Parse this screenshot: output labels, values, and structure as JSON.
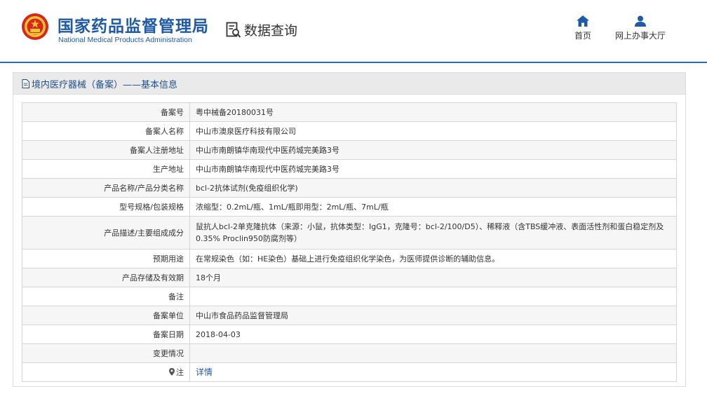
{
  "header": {
    "logo_cn": "国家药品监督管理局",
    "logo_en": "National Medical Products Administration",
    "query_label": "数据查询",
    "nav": [
      {
        "label": "首页",
        "icon": "home-icon"
      },
      {
        "label": "网上办事大厅",
        "icon": "user-icon"
      }
    ]
  },
  "panel": {
    "title": "境内医疗器械（备案）——基本信息"
  },
  "rows": [
    {
      "label": "备案号",
      "value": "粤中械备20180031号"
    },
    {
      "label": "备案人名称",
      "value": "中山市澳泉医疗科技有限公司"
    },
    {
      "label": "备案人注册地址",
      "value": "中山市南朗镇华南现代中医药城完美路3号"
    },
    {
      "label": "生产地址",
      "value": "中山市南朗镇华南现代中医药城完美路3号"
    },
    {
      "label": "产品名称/产品分类名称",
      "value": "bcl-2抗体试剂(免疫组织化学)"
    },
    {
      "label": "型号规格/包装规格",
      "value": "浓缩型：0.2mL/瓶、1mL/瓶即用型：2mL/瓶、7mL/瓶"
    },
    {
      "label": "产品描述/主要组成成分",
      "value": "鼠抗人bcl-2单克隆抗体（来源：小鼠，抗体类型：IgG1，克隆号：bcl-2/100/D5）、稀释液（含TBS缓冲液、表面活性剂和蛋白稳定剂及0.35% Proclin950防腐剂等）"
    },
    {
      "label": "预期用途",
      "value": "在常规染色（如：HE染色）基础上进行免疫组织化学染色，为医师提供诊断的辅助信息。"
    },
    {
      "label": "产品存储及有效期",
      "value": "18个月"
    },
    {
      "label": "备注",
      "value": ""
    },
    {
      "label": "备案单位",
      "value": "中山市食品药品监督管理局"
    },
    {
      "label": "备案日期",
      "value": "2018-04-03"
    },
    {
      "label": "变更情况",
      "value": ""
    }
  ],
  "note_row": {
    "label": "注",
    "link": "详情",
    "icon": "map-pin-icon"
  },
  "colors": {
    "brand_blue": "#1f5aa6",
    "panel_head_bg": "#eaeaea"
  }
}
